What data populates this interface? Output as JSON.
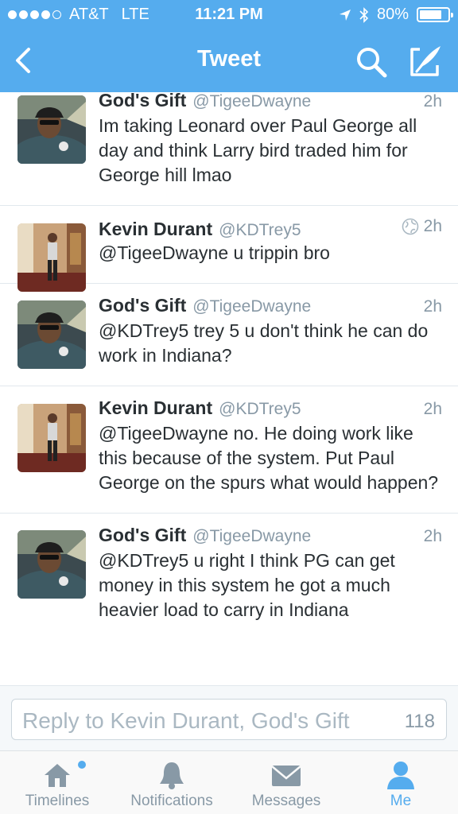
{
  "status_bar": {
    "carrier": "AT&T",
    "network": "LTE",
    "time": "11:21 PM",
    "battery": "80%",
    "battery_level": 0.8,
    "signal_bars_filled": 4,
    "signal_bars_total": 5
  },
  "nav": {
    "title": "Tweet",
    "back_icon": "chevron-left-icon",
    "search_icon": "search-icon",
    "compose_icon": "compose-icon"
  },
  "tweets": [
    {
      "name": "God's Gift",
      "handle": "@TigeeDwayne",
      "time": "2h",
      "text": "Im taking Leonard over Paul George all day and think Larry bird traded him for George hill lmao",
      "avatar": "gods-gift"
    },
    {
      "name": "Kevin Durant",
      "handle": "@KDTrey5",
      "time": "2h",
      "text": "@TigeeDwayne u trippin bro",
      "avatar": "kevin-durant",
      "globe": true
    },
    {
      "name": "God's Gift",
      "handle": "@TigeeDwayne",
      "time": "2h",
      "text": "@KDTrey5 trey 5 u don't think he can do work in Indiana?",
      "avatar": "gods-gift"
    },
    {
      "name": "Kevin Durant",
      "handle": "@KDTrey5",
      "time": "2h",
      "text": "@TigeeDwayne no. He doing work like this because of the system. Put Paul George on the spurs what would happen?",
      "avatar": "kevin-durant"
    },
    {
      "name": "God's Gift",
      "handle": "@TigeeDwayne",
      "time": "2h",
      "text": "@KDTrey5 u right I think PG can get money in this system he got a much heavier load to carry in Indiana",
      "avatar": "gods-gift"
    }
  ],
  "reply": {
    "placeholder": "Reply to Kevin Durant, God's Gift",
    "count": "118"
  },
  "tabs": [
    {
      "label": "Timelines",
      "icon": "home-icon",
      "active": false,
      "badge": true
    },
    {
      "label": "Notifications",
      "icon": "bell-icon",
      "active": false
    },
    {
      "label": "Messages",
      "icon": "envelope-icon",
      "active": false
    },
    {
      "label": "Me",
      "icon": "person-icon",
      "active": true
    }
  ],
  "colors": {
    "accent": "#55acee",
    "text": "#292f33",
    "muted": "#8899a6"
  }
}
